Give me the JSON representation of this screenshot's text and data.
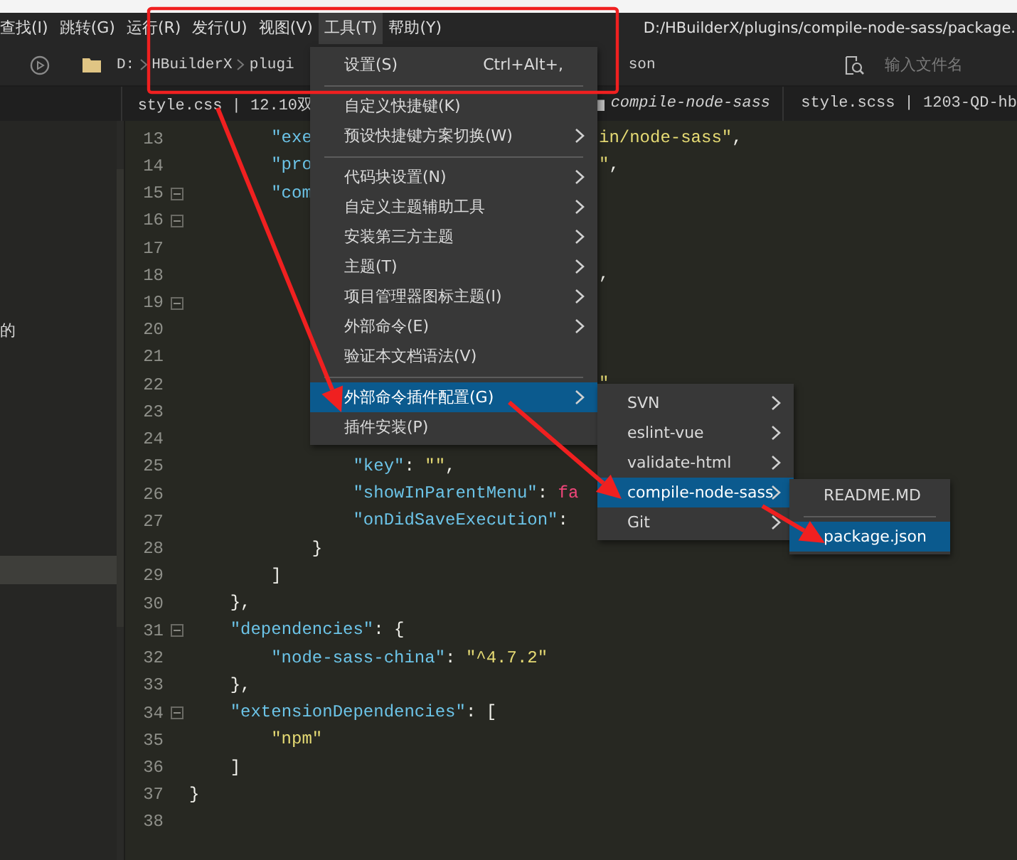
{
  "menubar": [
    {
      "label": "查找(I)",
      "selected": false
    },
    {
      "label": "跳转(G)",
      "selected": false
    },
    {
      "label": "运行(R)",
      "selected": false
    },
    {
      "label": "发行(U)",
      "selected": false
    },
    {
      "label": "视图(V)",
      "selected": false
    },
    {
      "label": "工具(T)",
      "selected": true
    },
    {
      "label": "帮助(Y)",
      "selected": false
    }
  ],
  "title_path": "D:/HBuilderX/plugins/compile-node-sass/package.",
  "breadcrumb": {
    "items": [
      "D:",
      "HBuilderX",
      "plugi"
    ],
    "tail": "son"
  },
  "file_search": {
    "placeholder": "输入文件名"
  },
  "tabs": [
    {
      "kind": "file",
      "label": "style.css | 12.10双"
    },
    {
      "kind": "folder",
      "label": "compile-node-sass"
    },
    {
      "kind": "file",
      "label": "style.scss | 1203-QD-hb"
    }
  ],
  "sidebar": {
    "rows": [
      {
        "label": "的",
        "selected": false
      },
      {
        "selected": true
      }
    ]
  },
  "editor": {
    "lines": [
      {
        "number": "13",
        "text": "        \"exe",
        "right": "in/node-sass\","
      },
      {
        "number": "14",
        "text": "        \"pro",
        "right": "\","
      },
      {
        "number": "15",
        "text": "        \"com",
        "fold": true
      },
      {
        "number": "16",
        "fold": true
      },
      {
        "number": "17"
      },
      {
        "number": "18",
        "right": ","
      },
      {
        "number": "19",
        "fold": true
      },
      {
        "number": "20"
      },
      {
        "number": "21"
      },
      {
        "number": "22",
        "right": "\""
      },
      {
        "number": "23"
      },
      {
        "number": "24"
      },
      {
        "number": "25",
        "text": "                \"key\": \"\","
      },
      {
        "number": "26",
        "text": "                \"showInParentMenu\": fa"
      },
      {
        "number": "27",
        "text": "                \"onDidSaveExecution\": "
      },
      {
        "number": "28",
        "text": "            }"
      },
      {
        "number": "29",
        "text": "        ]"
      },
      {
        "number": "30",
        "text": "    },"
      },
      {
        "number": "31",
        "text": "    \"dependencies\": {",
        "fold": true
      },
      {
        "number": "32",
        "text": "        \"node-sass-china\": \"^4.7.2\""
      },
      {
        "number": "33",
        "text": "    },"
      },
      {
        "number": "34",
        "text": "    \"extensionDependencies\": [",
        "fold": true
      },
      {
        "number": "35",
        "text": "        \"npm\""
      },
      {
        "number": "36",
        "text": "    ]"
      },
      {
        "number": "37",
        "text": "}"
      },
      {
        "number": "38"
      }
    ]
  },
  "menu": {
    "items": [
      {
        "kind": "item",
        "label": "设置(S)",
        "shortcut": "Ctrl+Alt+,",
        "submenu": false,
        "selected": false
      },
      {
        "kind": "separator"
      },
      {
        "kind": "item",
        "label": "自定义快捷键(K)",
        "submenu": false,
        "selected": false
      },
      {
        "kind": "item",
        "label": "预设快捷键方案切换(W)",
        "submenu": true,
        "selected": false
      },
      {
        "kind": "separator"
      },
      {
        "kind": "item",
        "label": "代码块设置(N)",
        "submenu": true,
        "selected": false
      },
      {
        "kind": "item",
        "label": "自定义主题辅助工具",
        "submenu": true,
        "selected": false
      },
      {
        "kind": "item",
        "label": "安装第三方主题",
        "submenu": true,
        "selected": false
      },
      {
        "kind": "item",
        "label": "主题(T)",
        "submenu": true,
        "selected": false
      },
      {
        "kind": "item",
        "label": "项目管理器图标主题(I)",
        "submenu": true,
        "selected": false
      },
      {
        "kind": "item",
        "label": "外部命令(E)",
        "submenu": true,
        "selected": false
      },
      {
        "kind": "item",
        "label": "验证本文档语法(V)",
        "submenu": false,
        "selected": false
      },
      {
        "kind": "separator"
      },
      {
        "kind": "item",
        "label": "外部命令插件配置(G)",
        "submenu": true,
        "selected": true
      },
      {
        "kind": "item",
        "label": "插件安装(P)",
        "submenu": false,
        "selected": false
      }
    ]
  },
  "plugin_menu": {
    "items": [
      {
        "kind": "item",
        "label": "SVN",
        "submenu": true,
        "selected": false
      },
      {
        "kind": "item",
        "label": "eslint-vue",
        "submenu": true,
        "selected": false
      },
      {
        "kind": "item",
        "label": "validate-html",
        "submenu": true,
        "selected": false
      },
      {
        "kind": "item",
        "label": "compile-node-sass",
        "submenu": true,
        "selected": true
      },
      {
        "kind": "item",
        "label": "Git",
        "submenu": true,
        "selected": false
      }
    ]
  },
  "file_menu": {
    "items": [
      {
        "kind": "item",
        "label": "README.MD",
        "submenu": false,
        "selected": false
      },
      {
        "kind": "separator"
      },
      {
        "kind": "item",
        "label": "package.json",
        "submenu": false,
        "selected": true
      }
    ]
  },
  "annotations": [
    {
      "kind": "frame"
    },
    {
      "kind": "arrow"
    },
    {
      "kind": "arrow"
    },
    {
      "kind": "arrow"
    }
  ]
}
